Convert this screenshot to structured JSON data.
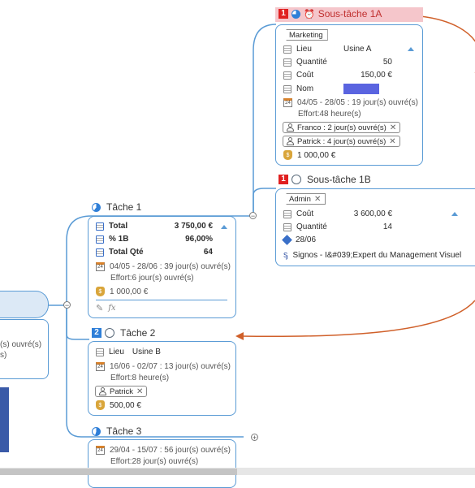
{
  "sub1a": {
    "priority": "1",
    "title": "Sous-tâche 1A",
    "tag": "Marketing",
    "fields": [
      {
        "label": "Lieu",
        "value": "Usine A"
      },
      {
        "label": "Quantité",
        "value": "50"
      },
      {
        "label": "Coût",
        "value": "150,00 €"
      },
      {
        "label": "Nom",
        "value": ""
      }
    ],
    "dates": "04/05 - 28/05 : 19 jour(s) ouvré(s)",
    "effort": "Effort:48 heure(s)",
    "resources": [
      "Franco : 2 jour(s) ouvré(s)",
      "Patrick : 4 jour(s) ouvré(s)"
    ],
    "cost": "1 000,00 €"
  },
  "sub1b": {
    "priority": "1",
    "title": "Sous-tâche 1B",
    "tag": "Admin",
    "fields": [
      {
        "label": "Coût",
        "value": "3 600,00 €"
      },
      {
        "label": "Quantité",
        "value": "14"
      }
    ],
    "milestone": "28/06",
    "link": "Signos - I&#039;Expert du Management Visuel"
  },
  "task1": {
    "title": "Tâche 1",
    "fields": [
      {
        "label": "Total",
        "value": "3 750,00  €"
      },
      {
        "label": "% 1B",
        "value": "96,00%"
      },
      {
        "label": "Total Qté",
        "value": "64"
      }
    ],
    "dates": "04/05 - 28/06 : 39 jour(s) ouvré(s)",
    "effort": "Effort:6 jour(s) ouvré(s)",
    "cost": "1 000,00 €",
    "formula": "fx"
  },
  "task2": {
    "priority": "2",
    "title": "Tâche 2",
    "field": {
      "label": "Lieu",
      "value": "Usine B"
    },
    "dates": "16/06 - 02/07 : 13 jour(s) ouvré(s)",
    "effort": "Effort:8 heure(s)",
    "resource": "Patrick",
    "cost": "500,00 €"
  },
  "task3": {
    "title": "Tâche 3",
    "dates": "29/04 - 15/07 : 56 jour(s) ouvré(s)",
    "effort": "Effort:28 jour(s) ouvré(s)"
  },
  "left": {
    "line1": "(s) ouvré(s)",
    "line2": "s)"
  },
  "calendar_day": "24",
  "colors": {
    "accent": "#5a9bd5",
    "priority": "#e02020",
    "priority2": "#2f7fd8",
    "arrow": "#d0602a"
  }
}
